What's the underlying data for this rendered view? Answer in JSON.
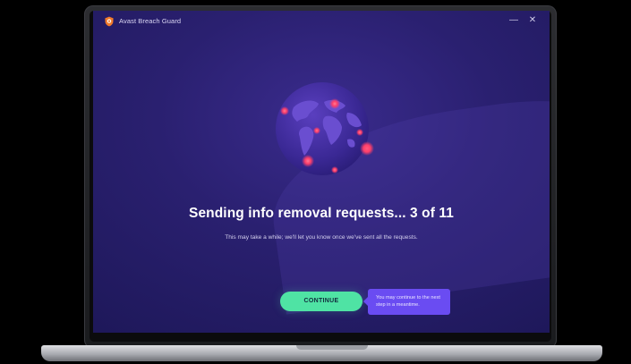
{
  "window": {
    "title": "Avast Breach Guard",
    "minimize_symbol": "—",
    "close_symbol": "✕"
  },
  "main": {
    "headline": "Sending info removal requests... 3 of 11",
    "subtext": "This may take a while; we'll let you know once we've sent all the requests.",
    "continue_label": "CONTINUE",
    "tooltip": "You may continue to the next step in a meantime."
  },
  "icons": {
    "app_logo": "avast-shield-icon",
    "globe": "globe-illustration"
  },
  "colors": {
    "background": "#241c66",
    "accent_button": "#4fe3a4",
    "tooltip": "#6a4cf2",
    "alert_dot": "#ff3f6a"
  }
}
